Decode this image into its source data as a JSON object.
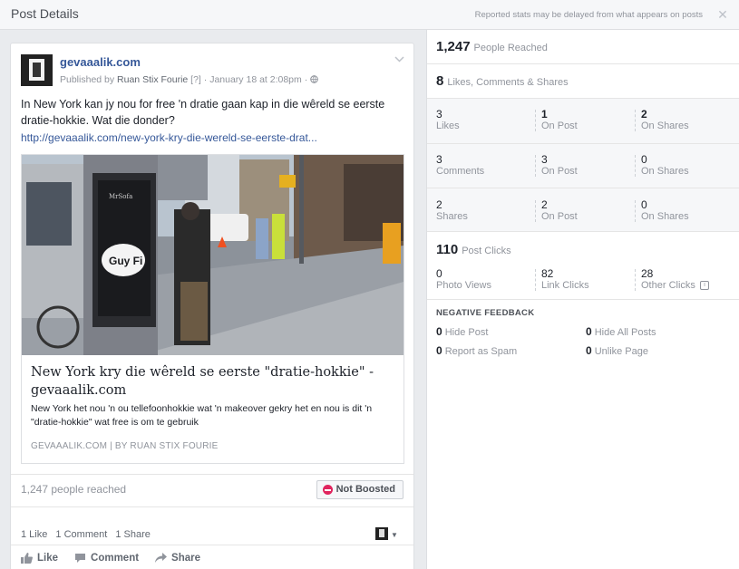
{
  "header": {
    "title": "Post Details",
    "note": "Reported stats may be delayed from what appears on posts",
    "close": "✕"
  },
  "post": {
    "page_name": "gevaaalik.com",
    "published_by": "Published by",
    "author": "Ruan Stix Fourie",
    "author_suffix": "[?]",
    "date": "January 18 at 2:08pm",
    "text": "In New York kan jy nou for free 'n dratie gaan kap in die wêreld se eerste dratie-hokkie. Wat die donder?",
    "link": "http://gevaaalik.com/new-york-kry-die-wereld-se-eerste-drat...",
    "link_card": {
      "photo_sign": "Guy Fi",
      "title": "New York kry die wêreld se eerste \"dratie-hokkie\" - gevaaalik.com",
      "description": "New York het nou 'n ou tellefoonhokkie wat 'n makeover gekry het en nou is dit 'n \"dratie-hokkie\" wat free is om te gebruik",
      "source": "GEVAAALIK.COM | BY RUAN STIX FOURIE"
    },
    "reached": "1,247 people reached",
    "boost_label": "Not Boosted",
    "counts": {
      "likes": "1 Like",
      "comments": "1 Comment",
      "shares": "1 Share"
    },
    "actions": {
      "like": "Like",
      "comment": "Comment",
      "share": "Share"
    }
  },
  "stats": {
    "reach_value": "1,247",
    "reach_label": "People Reached",
    "engagement_value": "8",
    "engagement_label": "Likes, Comments & Shares",
    "rows": [
      {
        "total": "3",
        "total_label": "Likes",
        "on_post": "1",
        "on_post_label": "On Post",
        "on_shares": "2",
        "on_shares_label": "On Shares"
      },
      {
        "total": "3",
        "total_label": "Comments",
        "on_post": "3",
        "on_post_label": "On Post",
        "on_shares": "0",
        "on_shares_label": "On Shares"
      },
      {
        "total": "2",
        "total_label": "Shares",
        "on_post": "2",
        "on_post_label": "On Post",
        "on_shares": "0",
        "on_shares_label": "On Shares"
      }
    ],
    "clicks_value": "110",
    "clicks_label": "Post Clicks",
    "clicks": {
      "photo_views": "0",
      "photo_views_label": "Photo Views",
      "link_clicks": "82",
      "link_clicks_label": "Link Clicks",
      "other_clicks": "28",
      "other_clicks_label": "Other Clicks"
    },
    "negative_heading": "NEGATIVE FEEDBACK",
    "negative": {
      "hide_post": "0",
      "hide_post_label": "Hide Post",
      "hide_all": "0",
      "hide_all_label": "Hide All Posts",
      "spam": "0",
      "spam_label": "Report as Spam",
      "unlike": "0",
      "unlike_label": "Unlike Page"
    }
  }
}
